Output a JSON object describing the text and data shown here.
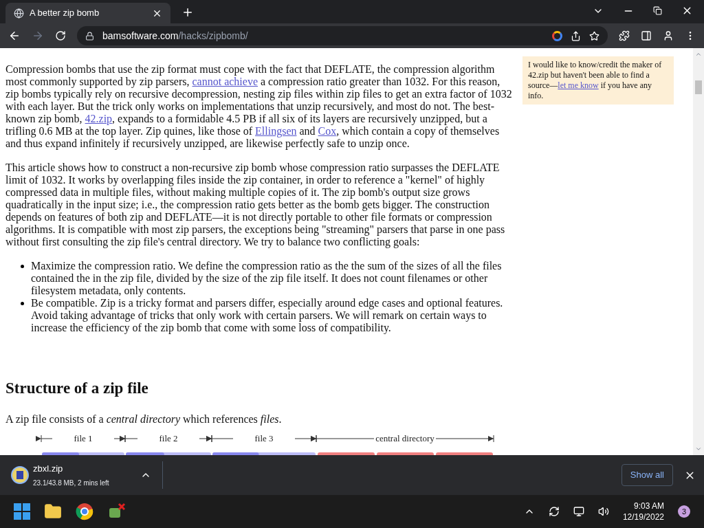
{
  "tab": {
    "title": "A better zip bomb",
    "selected": true
  },
  "address": {
    "host": "bamsoftware.com",
    "path": "/hacks/zipbomb/"
  },
  "article": {
    "paragraphs": [
      [
        {
          "kind": "text",
          "text": "Compression bombs that use the zip format must cope with the fact that DEFLATE, the compression algorithm most commonly supported by zip parsers, "
        },
        {
          "kind": "link",
          "text": "cannot achieve"
        },
        {
          "kind": "text",
          "text": " a compression ratio greater than 1032. For this reason, zip bombs typically rely on recursive decompression, nesting zip files within zip files to get an extra factor of 1032 with each layer. But the trick only works on implementations that unzip recursively, and most do not. The best-known zip bomb, "
        },
        {
          "kind": "link",
          "text": "42.zip"
        },
        {
          "kind": "text",
          "text": ", expands to a formidable 4.5 PB if all six of its layers are recursively unzipped, but a trifling 0.6 MB at the top layer. Zip quines, like those of "
        },
        {
          "kind": "link",
          "text": "Ellingsen"
        },
        {
          "kind": "text",
          "text": " and "
        },
        {
          "kind": "link",
          "text": "Cox"
        },
        {
          "kind": "text",
          "text": ", which contain a copy of themselves and thus expand infinitely if recursively unzipped, are likewise perfectly safe to unzip once."
        }
      ],
      [
        {
          "kind": "text",
          "text": "This article shows how to construct a non-recursive zip bomb whose compression ratio surpasses the DEFLATE limit of 1032. It works by overlapping files inside the zip container, in order to reference a \"kernel\" of highly compressed data in multiple files, without making multiple copies of it. The zip bomb's output size grows quadratically in the input size; i.e., the compression ratio gets better as the bomb gets bigger. The construction depends on features of both zip and DEFLATE—it is not directly portable to other file formats or compression algorithms. It is compatible with most zip parsers, the exceptions being \"streaming\" parsers that parse in one pass without first consulting the zip file's central directory. We try to balance two conflicting goals:"
        }
      ]
    ],
    "bullets": [
      "Maximize the compression ratio. We define the compression ratio as the the sum of the sizes of all the files contained the in the zip file, divided by the size of the zip file itself. It does not count filenames or other filesystem metadata, only contents.",
      "Be compatible. Zip is a tricky format and parsers differ, especially around edge cases and optional features. Avoid taking advantage of tricks that only work with certain parsers. We will remark on certain ways to increase the efficiency of the zip bomb that come with some loss of compatibility."
    ],
    "heading": "Structure of a zip file",
    "intro": "A zip file consists of a *central directory* which references *files*.",
    "diagram_segments": [
      {
        "label": "file 1",
        "kind": "file"
      },
      {
        "label": "file 2",
        "kind": "file"
      },
      {
        "label": "file 3",
        "kind": "file"
      },
      {
        "label": "central directory",
        "kind": "directory"
      }
    ]
  },
  "sidenote": [
    {
      "kind": "text",
      "text": "I would like to know/credit the maker of 42.zip but haven't been able to find a source—"
    },
    {
      "kind": "link",
      "text": "let me know"
    },
    {
      "kind": "text",
      "text": " if you have any info."
    }
  ],
  "download": {
    "filename": "zbxl.zip",
    "status": "23.1/43.8 MB, 2 mins left",
    "show_all": "Show all"
  },
  "taskbar": {
    "time": "9:03 AM",
    "date": "12/19/2022",
    "notifications": "3"
  }
}
